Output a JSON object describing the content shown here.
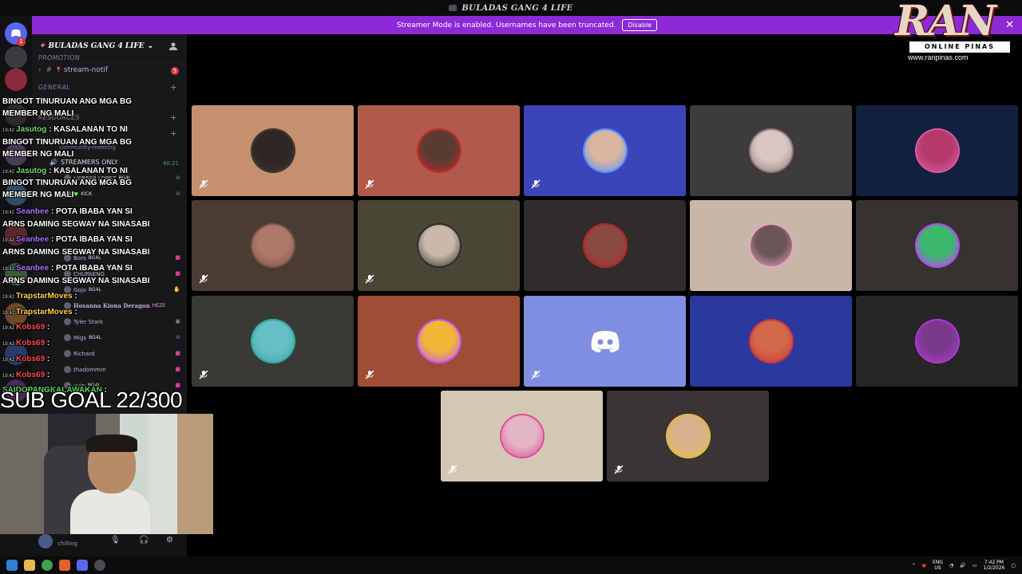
{
  "window": {
    "title": "BULADAS GANG 4 LIFE"
  },
  "banner": {
    "text": "Streamer Mode is enabled. Usernames have been truncated.",
    "disable_label": "Disable",
    "close": "✕",
    "color": "#8b2ad6"
  },
  "sidebar": {
    "server_name": "BULADAS GANG 4 LIFE",
    "category_promotion": "PROMOTION",
    "channel_stream_notif": "stream-notif",
    "stream_notif_badge": "5",
    "category_general": "GENERAL",
    "category_resources": "RESOURCES",
    "channel_community": "community-meeting",
    "channel_streamers": "STREAMERS ONLY",
    "voice_timer": "40:21",
    "voice_users": [
      {
        "name": "LJ0R5E9 LOPEZ",
        "tag": "BG4L"
      },
      {
        "name": "",
        "tag": "KICK"
      },
      {
        "name": "Bors",
        "tag": "BG4L"
      },
      {
        "name": "CHUPAENG",
        "tag": ""
      },
      {
        "name": "Gojo",
        "tag": "BG4L"
      },
      {
        "name": "Hosanna Kiona Deragon",
        "tag": "HEZE"
      },
      {
        "name": "Tyler Stark",
        "tag": ""
      },
      {
        "name": "Migs",
        "tag": "BG4L"
      },
      {
        "name": "Richard",
        "tag": ""
      },
      {
        "name": "thadommm",
        "tag": ""
      },
      {
        "name": "yuin",
        "tag": "BG4L"
      }
    ],
    "user_status": "chilling"
  },
  "chat": [
    {
      "ts": "",
      "name": "",
      "text": "BINGOT TINURUAN ANG MGA BG",
      "color": "#ffffff"
    },
    {
      "ts": "",
      "name": "",
      "text": "MEMBER NG MALI",
      "color": "#ffffff"
    },
    {
      "ts": "19:42",
      "name": "Jasutog",
      "text": ": KASALANAN TO NI",
      "color": "#7bd86e"
    },
    {
      "ts": "",
      "name": "",
      "text": "BINGOT TINURUAN ANG MGA BG",
      "color": "#ffffff"
    },
    {
      "ts": "",
      "name": "",
      "text": "MEMBER NG MALI",
      "color": "#ffffff"
    },
    {
      "ts": "19:42",
      "name": "Jasutog",
      "text": ": KASALANAN TO NI",
      "color": "#7bd86e"
    },
    {
      "ts": "",
      "name": "",
      "text": "BINGOT TINURUAN ANG MGA BG",
      "color": "#ffffff"
    },
    {
      "ts": "",
      "name": "",
      "text": "MEMBER NG MALI",
      "color": "#ffffff"
    },
    {
      "ts": "19:42",
      "name": "Seanbee",
      "text": ": POTA IBABA YAN SI",
      "color": "#a970ff"
    },
    {
      "ts": "",
      "name": "",
      "text": "ARNS DAMING SEGWAY NA SINASABI",
      "color": "#ffffff"
    },
    {
      "ts": "19:42",
      "name": "Seanbee",
      "text": ": POTA IBABA YAN SI",
      "color": "#a970ff"
    },
    {
      "ts": "",
      "name": "",
      "text": "ARNS DAMING SEGWAY NA SINASABI",
      "color": "#ffffff"
    },
    {
      "ts": "19:42",
      "name": "Seanbee",
      "text": ": POTA IBABA YAN SI",
      "color": "#a970ff"
    },
    {
      "ts": "",
      "name": "",
      "text": "ARNS DAMING SEGWAY NA SINASABI",
      "color": "#ffffff"
    },
    {
      "ts": "19:42",
      "name": "TrapstarMoves",
      "text": ":",
      "color": "#ffd24a"
    },
    {
      "ts": "19:42",
      "name": "TrapstarMoves",
      "text": ":",
      "color": "#ffd24a"
    },
    {
      "ts": "19:42",
      "name": "Kobs69",
      "text": ":",
      "color": "#ff4d4d"
    },
    {
      "ts": "19:42",
      "name": "Kobs69",
      "text": ":",
      "color": "#ff4d4d"
    },
    {
      "ts": "19:42",
      "name": "Kobs69",
      "text": ":",
      "color": "#ff4d4d"
    },
    {
      "ts": "19:42",
      "name": "Kobs69",
      "text": ":",
      "color": "#ff4d4d"
    },
    {
      "ts": "",
      "name": "SAIDOPANGKALAWAKAN",
      "text": ":",
      "color": "#57d657"
    }
  ],
  "sub_goal": "SUB GOAL 22/300",
  "logo": {
    "brand": "RAN",
    "tagline": "ONLINE PINAS",
    "url": "www.ranpinas.com"
  },
  "tiles": [
    {
      "bg": "#c4906e",
      "avatar": "#2d2624",
      "ring": "#3b3230",
      "muted": true
    },
    {
      "bg": "#b25a4a",
      "avatar": "#5a3b33",
      "ring": "#c22a2a",
      "muted": true
    },
    {
      "bg": "#3b45b8",
      "avatar": "#d8b6a0",
      "ring": "#5a8cff",
      "muted": true
    },
    {
      "bg": "#3d3b3b",
      "avatar": "#d9c7c4",
      "ring": "#8a7a78",
      "muted": false
    },
    {
      "bg": "#13203d",
      "avatar": "#b43a6a",
      "ring": "#e05aa8",
      "muted": false
    },
    {
      "bg": "#4a3c33",
      "avatar": "#b07a6a",
      "ring": "#7a5546",
      "muted": true
    },
    {
      "bg": "#4a4636",
      "avatar": "#c8b9a8",
      "ring": "#2f2c24",
      "muted": true
    },
    {
      "bg": "#2f2c2b",
      "avatar": "#8a4a44",
      "ring": "#b02a28",
      "muted": false
    },
    {
      "bg": "#c9b6aa",
      "avatar": "#6a5557",
      "ring": "#e8a7c0",
      "muted": false
    },
    {
      "bg": "#36322f",
      "avatar": "#3bb86a",
      "ring": "#c042ff",
      "muted": false
    },
    {
      "bg": "#383a35",
      "avatar": "#64c0c4",
      "ring": "#3aa8a8",
      "muted": true
    },
    {
      "bg": "#a04d36",
      "avatar": "#f0b836",
      "ring": "#c050ff",
      "muted": true
    },
    {
      "bg": "#7f8ee0",
      "avatar": "discord-logo",
      "ring": "#7f8ee0",
      "muted": true
    },
    {
      "bg": "#2b389e",
      "avatar": "#d06a4a",
      "ring": "#d03434",
      "muted": false
    },
    {
      "bg": "#262527",
      "avatar": "#7a3a8a",
      "ring": "#b03ad8",
      "muted": false
    },
    {
      "bg": "#d2c8b3",
      "avatar": "#e3b6c7",
      "ring": "#e04a9a",
      "muted": true
    },
    {
      "bg": "#3a3434",
      "avatar": "#d8b08a",
      "ring": "#e8c34a",
      "muted": true
    }
  ],
  "taskbar": {
    "lang": "ENG",
    "region": "US",
    "time": "7:42 PM",
    "date": "1/2/2026",
    "apps": [
      "windows-start",
      "file-explorer",
      "chrome",
      "office",
      "discord",
      "obs"
    ]
  }
}
